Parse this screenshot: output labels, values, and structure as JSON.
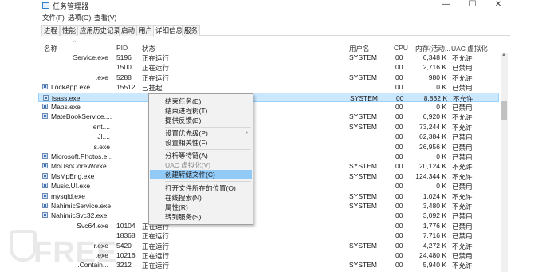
{
  "window": {
    "title": "任务管理器",
    "controls": [
      "—",
      "☐",
      "✕"
    ]
  },
  "menubar": {
    "items": [
      "文件(F)",
      "选项(O)",
      "查看(V)"
    ]
  },
  "tabs": [
    "进程",
    "性能",
    "应用历史记录",
    "启动",
    "用户",
    "详细信息",
    "服务"
  ],
  "active_tab": "详细信息",
  "columns": {
    "name": "名称",
    "pid": "PID",
    "status": "状态",
    "user": "用户名",
    "cpu": "CPU",
    "memory": "内存(活动...",
    "uac": "UAC 虚拟化"
  },
  "rows": [
    {
      "name": "Service.exe",
      "pid": "5196",
      "status": "正在运行",
      "user": "SYSTEM",
      "cpu": "00",
      "mem": "6,348 K",
      "uac": "不允许"
    },
    {
      "name": "",
      "pid": "1500",
      "status": "正在运行",
      "user": "",
      "cpu": "00",
      "mem": "2,716 K",
      "uac": "已禁用"
    },
    {
      "name": ".exe",
      "pid": "5288",
      "status": "正在运行",
      "user": "SYSTEM",
      "cpu": "00",
      "mem": "980 K",
      "uac": "不允许"
    },
    {
      "name": "LockApp.exe",
      "pid": "15512",
      "status": "已挂起",
      "user": "",
      "cpu": "00",
      "mem": "0 K",
      "uac": "已禁用"
    },
    {
      "name": "lsass.exe",
      "pid": "",
      "status": "",
      "user": "SYSTEM",
      "cpu": "00",
      "mem": "8,832 K",
      "uac": "不允许"
    },
    {
      "name": "Maps.exe",
      "pid": "",
      "status": "",
      "user": "",
      "cpu": "00",
      "mem": "0 K",
      "uac": "已禁用"
    },
    {
      "name": "MateBookService....",
      "pid": "",
      "status": "",
      "user": "SYSTEM",
      "cpu": "00",
      "mem": "6,920 K",
      "uac": "不允许"
    },
    {
      "name": "ent....",
      "pid": "",
      "status": "",
      "user": "SYSTEM",
      "cpu": "00",
      "mem": "73,244 K",
      "uac": "不允许"
    },
    {
      "name": "Jl....",
      "pid": "",
      "status": "",
      "user": "",
      "cpu": "00",
      "mem": "62,384 K",
      "uac": "已禁用"
    },
    {
      "name": "s.exe",
      "pid": "",
      "status": "",
      "user": "",
      "cpu": "00",
      "mem": "26,956 K",
      "uac": "已禁用"
    },
    {
      "name": "Microsoft.Photos.e...",
      "pid": "",
      "status": "",
      "user": "",
      "cpu": "00",
      "mem": "0 K",
      "uac": "已禁用"
    },
    {
      "name": "MoUsoCoreWorke...",
      "pid": "",
      "status": "",
      "user": "SYSTEM",
      "cpu": "00",
      "mem": "20,124 K",
      "uac": "不允许"
    },
    {
      "name": "MsMpEng.exe",
      "pid": "",
      "status": "",
      "user": "SYSTEM",
      "cpu": "00",
      "mem": "124,344 K",
      "uac": "不允许"
    },
    {
      "name": "Music.UI.exe",
      "pid": "",
      "status": "",
      "user": "",
      "cpu": "00",
      "mem": "0 K",
      "uac": "已禁用"
    },
    {
      "name": "mysqld.exe",
      "pid": "",
      "status": "",
      "user": "SYSTEM",
      "cpu": "00",
      "mem": "1,024 K",
      "uac": "不允许"
    },
    {
      "name": "NahimicService.exe",
      "pid": "",
      "status": "",
      "user": "SYSTEM",
      "cpu": "00",
      "mem": "3,480 K",
      "uac": "不允许"
    },
    {
      "name": "NahimicSvc32.exe",
      "pid": "",
      "status": "",
      "user": "",
      "cpu": "00",
      "mem": "3,092 K",
      "uac": "已禁用"
    },
    {
      "name": "Svc64.exe",
      "pid": "10104",
      "status": "正在运行",
      "user": "",
      "cpu": "00",
      "mem": "1,776 K",
      "uac": "已禁用"
    },
    {
      "name": "",
      "pid": "18368",
      "status": "正在运行",
      "user": "",
      "cpu": "00",
      "mem": "7,716 K",
      "uac": "已禁用"
    },
    {
      "name": "r.exe",
      "pid": "5420",
      "status": "正在运行",
      "user": "SYSTEM",
      "cpu": "00",
      "mem": "4,272 K",
      "uac": "不允许"
    },
    {
      "name": ".exe",
      "pid": "10216",
      "status": "正在运行",
      "user": "",
      "cpu": "00",
      "mem": "24,480 K",
      "uac": "已禁用"
    },
    {
      "name": ".Contain...",
      "pid": "3212",
      "status": "正在运行",
      "user": "SYSTEM",
      "cpu": "00",
      "mem": "5,940 K",
      "uac": "不允许"
    }
  ],
  "context_menu": {
    "items": [
      {
        "label": "结束任务(E)"
      },
      {
        "label": "结束进程树(T)"
      },
      {
        "label": "提供反馈(B)"
      },
      {
        "label": "设置优先级(P)"
      },
      {
        "label": "设置相关性(F)"
      },
      {
        "label": "分析等待链(A)"
      },
      {
        "label": "UAC 虚拟化(V)"
      },
      {
        "label": "创建转储文件(C)"
      },
      {
        "label": "打开文件所在的位置(O)"
      },
      {
        "label": "在线搜索(N)"
      },
      {
        "label": "属性(R)"
      },
      {
        "label": "转到服务(S)"
      }
    ],
    "submenu_arrow": "›"
  },
  "watermark": "FREE"
}
